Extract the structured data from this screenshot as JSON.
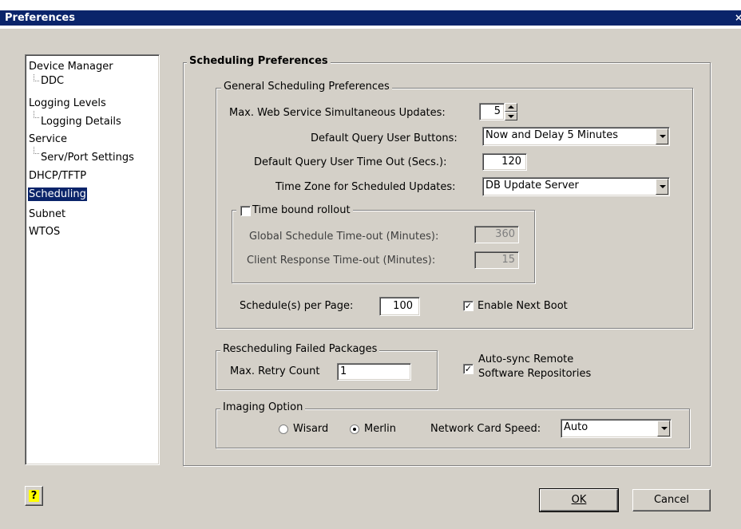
{
  "window": {
    "title": "Preferences",
    "close_glyph": "×"
  },
  "tree": {
    "items": [
      {
        "label": "Device Manager"
      },
      {
        "label": "DDC"
      },
      {
        "label": "Logging Levels"
      },
      {
        "label": "Logging Details"
      },
      {
        "label": "Service"
      },
      {
        "label": "Serv/Port Settings"
      },
      {
        "label": "DHCP/TFTP"
      },
      {
        "label": "Scheduling",
        "selected": true
      },
      {
        "label": "Subnet"
      },
      {
        "label": "WTOS"
      }
    ]
  },
  "scheduling": {
    "title": "Scheduling Preferences",
    "general": {
      "title": "General Scheduling Preferences",
      "max_updates_label": "Max. Web Service Simultaneous Updates:",
      "max_updates_value": "5",
      "query_buttons_label": "Default Query User Buttons:",
      "query_buttons_value": "Now and Delay 5 Minutes",
      "timeout_label": "Default Query User Time Out (Secs.):",
      "timeout_value": "120",
      "timezone_label": "Time Zone for Scheduled Updates:",
      "timezone_value": "DB Update Server",
      "time_bound": {
        "label": "Time bound rollout",
        "checked": false,
        "global_label": "Global Schedule Time-out (Minutes):",
        "global_value": "360",
        "client_label": "Client Response Time-out  (Minutes):",
        "client_value": "15"
      },
      "per_page_label": "Schedule(s) per Page:",
      "per_page_value": "100",
      "next_boot_label": "Enable Next Boot",
      "next_boot_checked": true
    },
    "rescheduling": {
      "title": "Rescheduling Failed Packages",
      "retry_label": "Max. Retry Count",
      "retry_value": "1"
    },
    "autosync": {
      "label_line1": "Auto-sync Remote",
      "label_line2": "Software Repositories",
      "checked": true
    },
    "imaging": {
      "title": "Imaging Option",
      "options": [
        "Wisard",
        "Merlin"
      ],
      "selected": "Merlin",
      "nic_label": "Network Card Speed:",
      "nic_value": "Auto"
    }
  },
  "buttons": {
    "help_glyph": "?",
    "ok": "OK",
    "cancel": "Cancel"
  },
  "colors": {
    "title_bar": "#0a246a",
    "dialog_bg": "#d4d0c8",
    "selection": "#0a246a"
  },
  "icons": [
    "close-icon",
    "help-icon",
    "spin-up-icon",
    "spin-down-icon",
    "dropdown-arrow-icon"
  ]
}
